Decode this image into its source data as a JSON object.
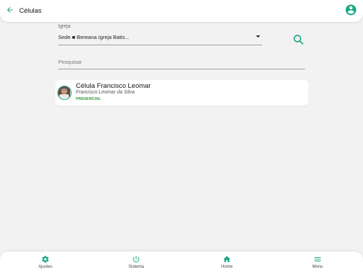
{
  "appbar": {
    "title": "Células",
    "back_icon": "arrow-left-icon",
    "account_icon": "account-circle-icon",
    "accent_color": "#1aa886"
  },
  "filters": {
    "select_label": "Igreja",
    "select_value": "Sede ■ Bereana Igreja Batis...",
    "search_placeholder": "Pesquisar",
    "search_icon": "search-icon"
  },
  "cells": [
    {
      "title": "Célula Francisco Leomar",
      "leader": "Francisco Leomar da Silva",
      "badge": "PRESENCIAL",
      "badge_color": "#2e9d3a"
    }
  ],
  "bottom_nav": {
    "items": [
      {
        "label": "Ajustes",
        "icon": "gear-icon"
      },
      {
        "label": "Sistema",
        "icon": "power-icon"
      },
      {
        "label": "Home",
        "icon": "home-icon"
      },
      {
        "label": "Menu",
        "icon": "menu-icon"
      }
    ],
    "icon_color": "#1aa886"
  }
}
